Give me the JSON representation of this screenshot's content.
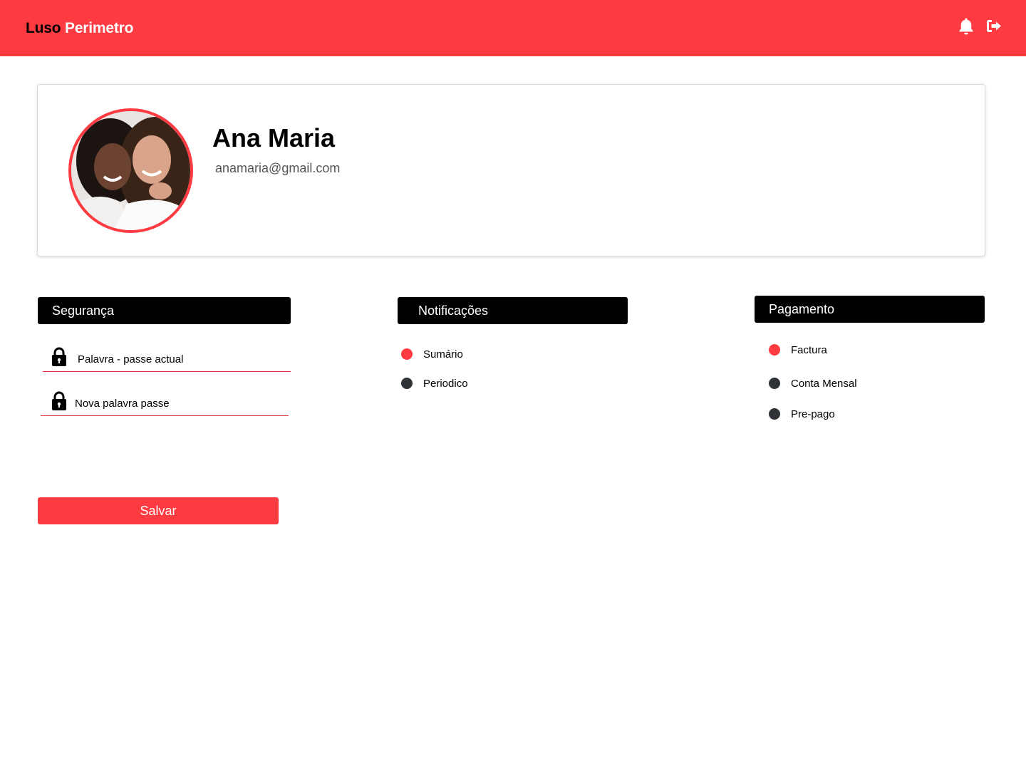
{
  "header": {
    "brand_part1": "Luso",
    "brand_part2": "Perimetro",
    "icons": [
      "bell-icon",
      "logout-icon"
    ],
    "background_color": "#ff3b42"
  },
  "profile": {
    "name": "Ana Maria",
    "email": "anamaria@gmail.com",
    "avatar": "profile-photo"
  },
  "security": {
    "title": "Segurança",
    "fields": [
      {
        "label": "Palavra - passe actual",
        "icon": "lock-icon"
      },
      {
        "label": "Nova palavra passe",
        "icon": "lock-icon"
      }
    ]
  },
  "notifications": {
    "title": "Notificações",
    "options": [
      {
        "label": "Sumário",
        "selected": true
      },
      {
        "label": "Periodico",
        "selected": false
      }
    ]
  },
  "payment": {
    "title": "Pagamento",
    "options": [
      {
        "label": "Factura",
        "selected": true
      },
      {
        "label": "Conta Mensal",
        "selected": false
      },
      {
        "label": "Pre-pago",
        "selected": false
      }
    ]
  },
  "actions": {
    "save_label": "Salvar"
  },
  "colors": {
    "accent": "#ff3b42",
    "selected_dot": "#ff3b42",
    "unselected_dot": "#2f3337",
    "section_header": "#000000"
  }
}
